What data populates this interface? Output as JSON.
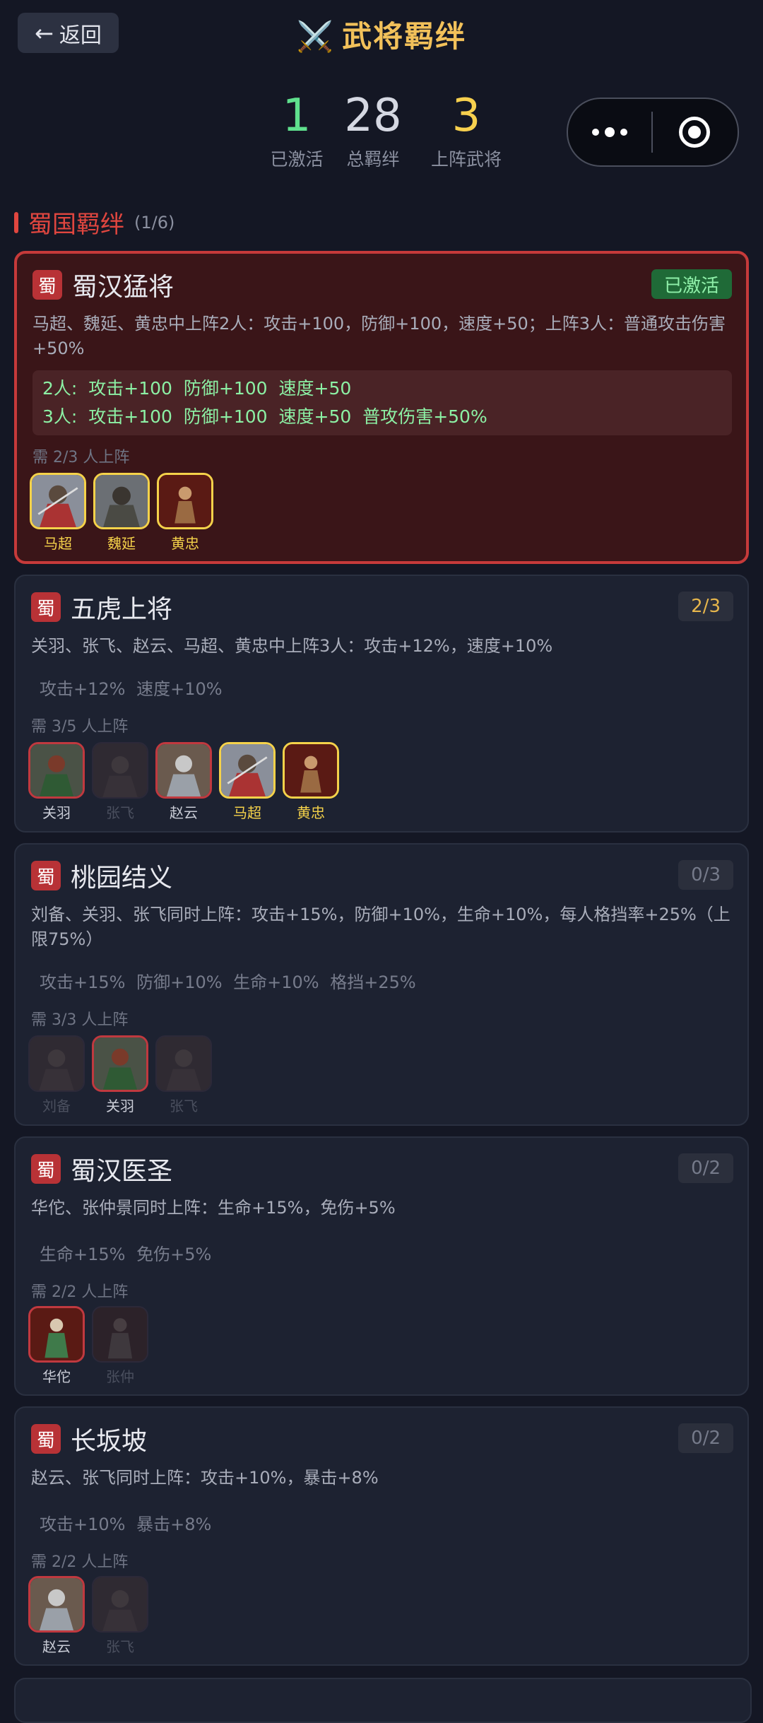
{
  "header": {
    "back_label": "返回",
    "title": "武将羁绊"
  },
  "stats": [
    {
      "value": "1",
      "label": "已激活"
    },
    {
      "value": "28",
      "label": "总羁绊"
    },
    {
      "value": "3",
      "label": "上阵武将"
    }
  ],
  "section": {
    "name": "蜀国羁绊",
    "count": "(1/6)"
  },
  "cards": [
    {
      "tag": "蜀",
      "title": "蜀汉猛将",
      "badge": "已激活",
      "desc": "马超、魏延、黄忠中上阵2人：攻击+100，防御+100，速度+50；上阵3人：普通攻击伤害+50%",
      "tiers": [
        "2人: 攻击+100  防御+100  速度+50",
        "3人: 攻击+100  防御+100  速度+50  普攻伤害+50%"
      ],
      "need": "需 2/3 人上阵",
      "heroes": [
        "马超",
        "魏延",
        "黄忠"
      ]
    },
    {
      "tag": "蜀",
      "title": "五虎上将",
      "badge": "2/3",
      "desc": "关羽、张飞、赵云、马超、黄忠中上阵3人：攻击+12%，速度+10%",
      "effects": "攻击+12%  速度+10%",
      "need": "需 3/5 人上阵",
      "heroes": [
        "关羽",
        "张飞",
        "赵云",
        "马超",
        "黄忠"
      ]
    },
    {
      "tag": "蜀",
      "title": "桃园结义",
      "badge": "0/3",
      "desc": "刘备、关羽、张飞同时上阵：攻击+15%，防御+10%，生命+10%，每人格挡率+25%（上限75%）",
      "effects": "攻击+15%  防御+10%  生命+10%  格挡+25%",
      "need": "需 3/3 人上阵",
      "heroes": [
        "刘备",
        "关羽",
        "张飞"
      ]
    },
    {
      "tag": "蜀",
      "title": "蜀汉医圣",
      "badge": "0/2",
      "desc": "华佗、张仲景同时上阵：生命+15%，免伤+5%",
      "effects": "生命+15%  免伤+5%",
      "need": "需 2/2 人上阵",
      "heroes": [
        "华佗",
        "张仲"
      ]
    },
    {
      "tag": "蜀",
      "title": "长坂坡",
      "badge": "0/2",
      "desc": "赵云、张飞同时上阵：攻击+10%，暴击+8%",
      "effects": "攻击+10%  暴击+8%",
      "need": "需 2/2 人上阵",
      "heroes": [
        "赵云",
        "张飞"
      ]
    }
  ]
}
